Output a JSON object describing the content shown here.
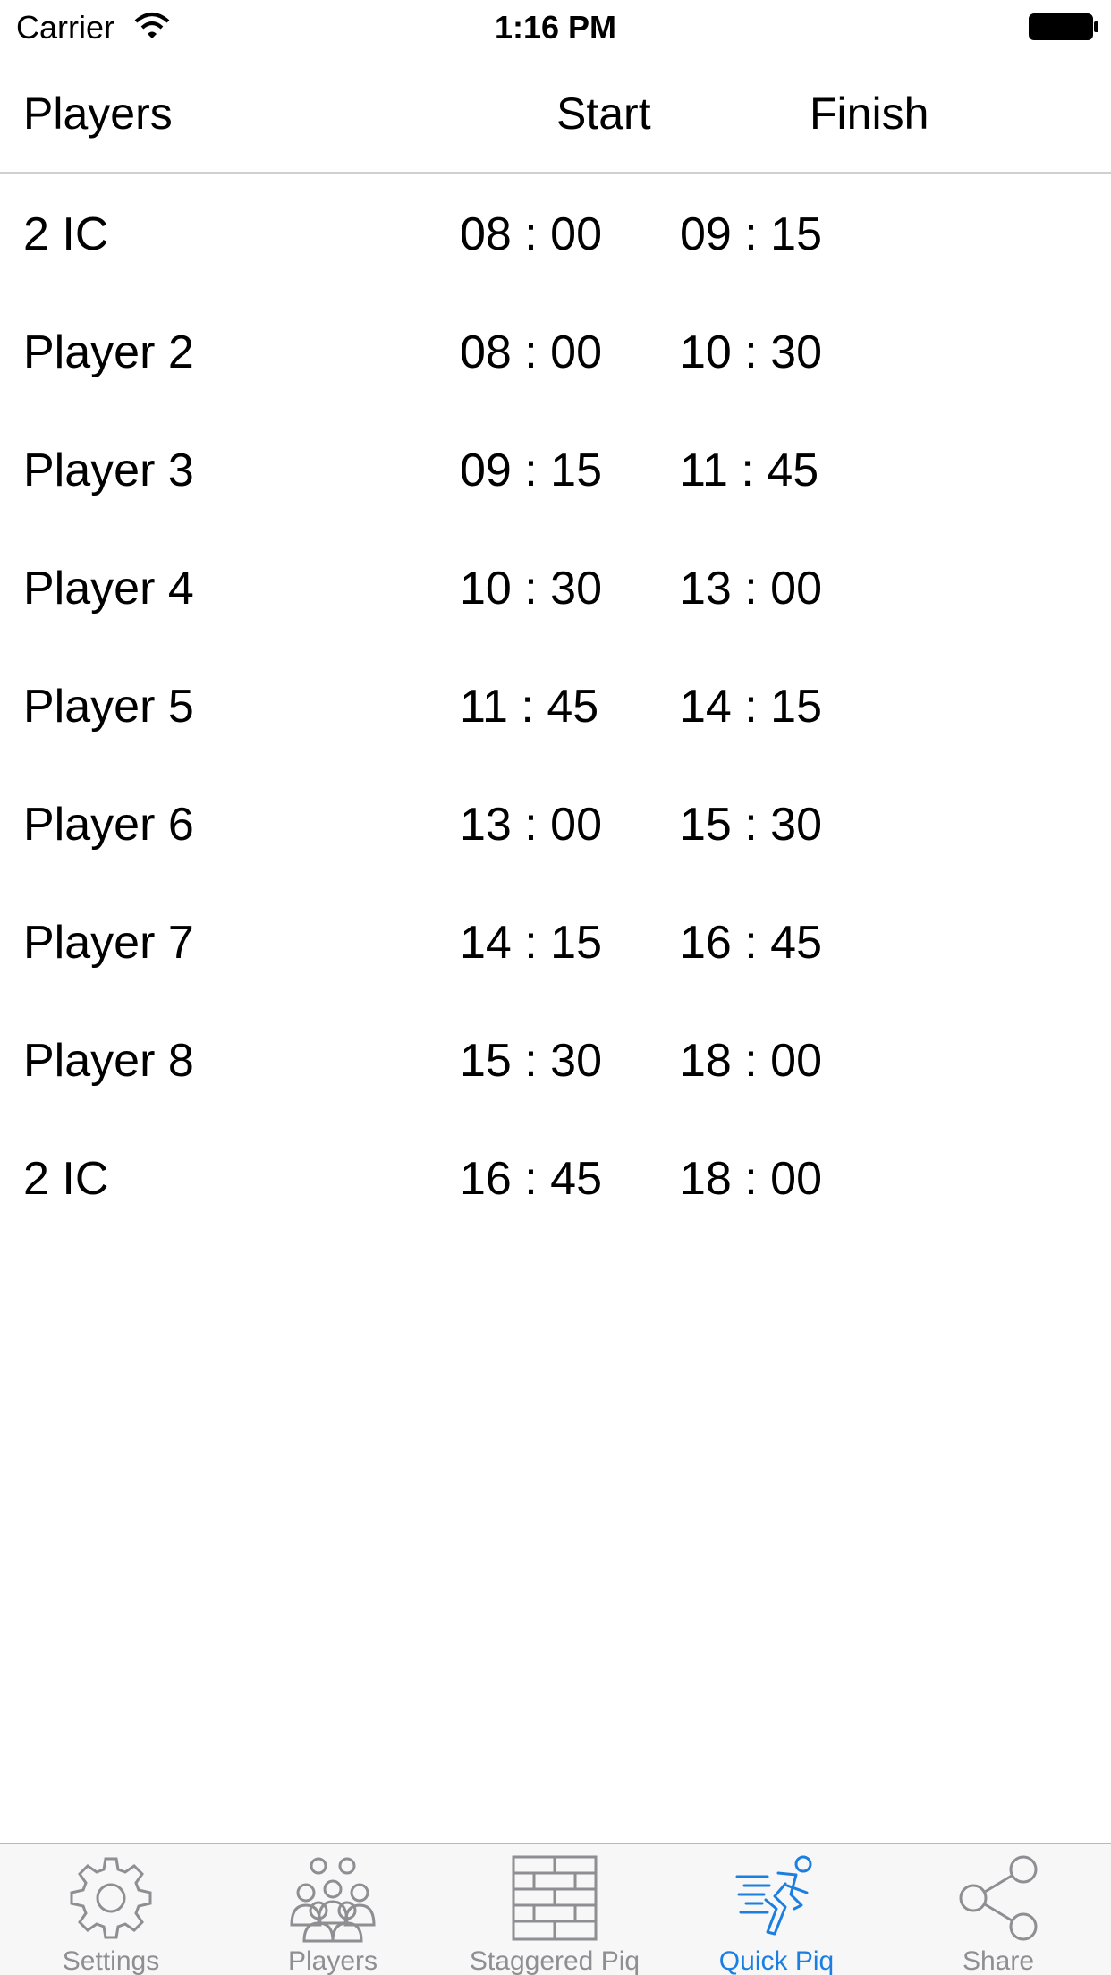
{
  "status_bar": {
    "carrier": "Carrier",
    "time": "1:16 PM"
  },
  "header": {
    "players": "Players",
    "start": "Start",
    "finish": "Finish"
  },
  "rows": [
    {
      "name": "2 IC",
      "start": "08 : 00",
      "finish": "09 : 15"
    },
    {
      "name": "Player 2",
      "start": "08 : 00",
      "finish": "10 : 30"
    },
    {
      "name": "Player 3",
      "start": "09 : 15",
      "finish": "11 : 45"
    },
    {
      "name": "Player 4",
      "start": "10 : 30",
      "finish": "13 : 00"
    },
    {
      "name": "Player 5",
      "start": "11 : 45",
      "finish": "14 : 15"
    },
    {
      "name": "Player 6",
      "start": "13 : 00",
      "finish": "15 : 30"
    },
    {
      "name": "Player 7",
      "start": "14 : 15",
      "finish": "16 : 45"
    },
    {
      "name": "Player 8",
      "start": "15 : 30",
      "finish": "18 : 00"
    },
    {
      "name": "2 IC",
      "start": "16 : 45",
      "finish": "18 : 00"
    }
  ],
  "tabbar": {
    "active_color": "#1a7fe0",
    "inactive_color": "#8e8e93",
    "tabs": [
      {
        "label": "Settings",
        "icon": "gear-icon",
        "active": false
      },
      {
        "label": "Players",
        "icon": "people-group-icon",
        "active": false
      },
      {
        "label": "Staggered Piq",
        "icon": "brick-wall-icon",
        "active": false
      },
      {
        "label": "Quick Piq",
        "icon": "running-person-icon",
        "active": true
      },
      {
        "label": "Share",
        "icon": "share-icon",
        "active": false
      }
    ]
  }
}
